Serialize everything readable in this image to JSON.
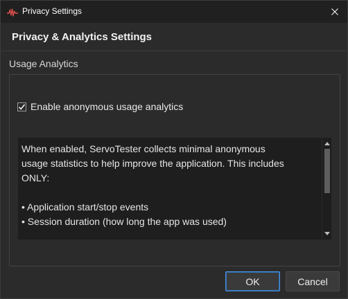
{
  "window": {
    "title": "Privacy Settings",
    "icon": "servo-pulse-icon",
    "close_icon": "close-icon"
  },
  "dialog": {
    "heading": "Privacy & Analytics Settings"
  },
  "group": {
    "label": "Usage Analytics",
    "checkbox": {
      "label": "Enable anonymous usage analytics",
      "checked": true
    },
    "description_lines": [
      "When enabled, ServoTester collects minimal anonymous",
      "usage statistics to help improve the application. This includes",
      "ONLY:",
      "",
      "• Application start/stop events",
      "• Session duration (how long the app was used)"
    ]
  },
  "buttons": {
    "ok_label": "OK",
    "cancel_label": "Cancel"
  },
  "colors": {
    "accent": "#4a90d9",
    "brand_icon": "#e0504a"
  }
}
